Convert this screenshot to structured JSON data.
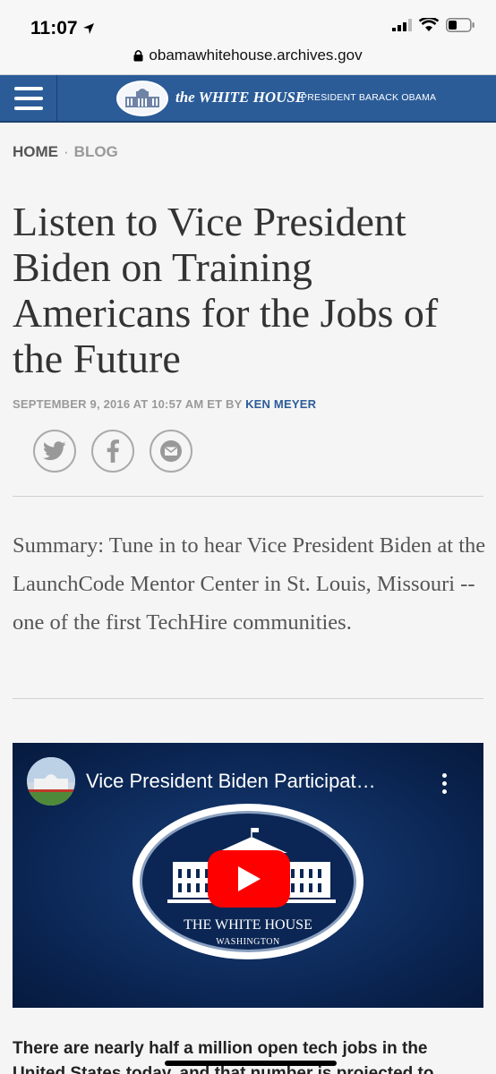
{
  "status": {
    "time": "11:07"
  },
  "browser": {
    "url": "obamawhitehouse.archives.gov"
  },
  "nav": {
    "brand": "the WHITE HOUSE",
    "subtitle": "PRESIDENT BARACK OBAMA"
  },
  "breadcrumb": {
    "home": "HOME",
    "separator": "·",
    "blog": "BLOG"
  },
  "article": {
    "title": "Listen to Vice President Biden on Training Americans for the Jobs of the Future",
    "date": "SEPTEMBER 9, 2016 AT 10:57 AM ET BY",
    "author": "KEN MEYER",
    "summary": "Summary: Tune in to hear Vice President Biden at the LaunchCode Mentor Center in St. Louis, Missouri -- one of the first TechHire communities.",
    "body_line1": "There are nearly half a million open tech jobs in the",
    "body_line2": "United States today, and that number is projected to"
  },
  "share": {
    "icons": [
      "twitter-icon",
      "facebook-icon",
      "email-icon"
    ]
  },
  "video": {
    "title": "Vice President Biden Participat…",
    "logo_line1": "THE WHITE HOUSE",
    "logo_line2": "WASHINGTON"
  },
  "colors": {
    "nav_blue": "#2b5c98",
    "author_link": "#2b5c98",
    "play_red": "#ff0000",
    "video_bg": "#0b2654"
  }
}
